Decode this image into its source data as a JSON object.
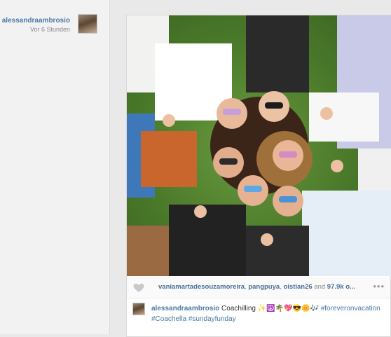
{
  "sidebar_user": {
    "username": "alessandraambrosio",
    "time": "Vor 6 Stunden"
  },
  "post": {
    "likes": {
      "user1": "vaniamartadesouzamoreira",
      "sep1": ", ",
      "user2": "pangpuya",
      "sep2": ", ",
      "user3": "oistian26",
      "and": " and ",
      "count": "97.9k o...",
      "more_label": "•••"
    },
    "caption": {
      "username": "alessandraambrosio",
      "text": "Coachilling ✨☮️🌴💖😎🌼🎶",
      "tag1": "#foreveronvacation",
      "tag2": "#Coachella",
      "tag3": "#sundayfunday"
    }
  }
}
